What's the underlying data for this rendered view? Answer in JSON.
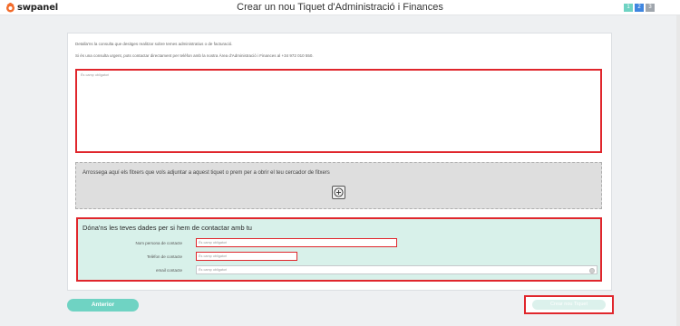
{
  "header": {
    "logo_text": "swpanel",
    "title": "Crear un nou Tiquet d'Administració i Finances",
    "steps": [
      "1",
      "2",
      "3"
    ]
  },
  "intro": {
    "line1": "Detalla'ns la consulta que desitges realitzar sobre temes administratius o de facturació.",
    "line2": "Si és una consulta urgent, pots contactar directament per telèfon amb la nostra Àrea d'Administració i Finances al +34 972 010 550."
  },
  "message": {
    "placeholder": "És camp obligatori"
  },
  "dropzone": {
    "text": "Arrossega aquí els fitxers que vols adjuntar a aquest tiquet o prem per a obrir el teu cercador de fitxers"
  },
  "contact": {
    "title": "Dóna'ns les teves dades per si hem de contactar amb tu",
    "fields": [
      {
        "label": "Nom persona de contacte",
        "placeholder": "És camp obligatori"
      },
      {
        "label": "Telèfon de contacte",
        "placeholder": "És camp obligatori"
      },
      {
        "label": "email contacte",
        "placeholder": "És camp obligatori"
      }
    ]
  },
  "footer": {
    "prev_label": "Anterior",
    "next_label": "Crear nou Tiquet"
  },
  "colors": {
    "accent": "#6fd3c3",
    "highlight": "#e0262c",
    "contact_bg": "#d8f1ea"
  }
}
